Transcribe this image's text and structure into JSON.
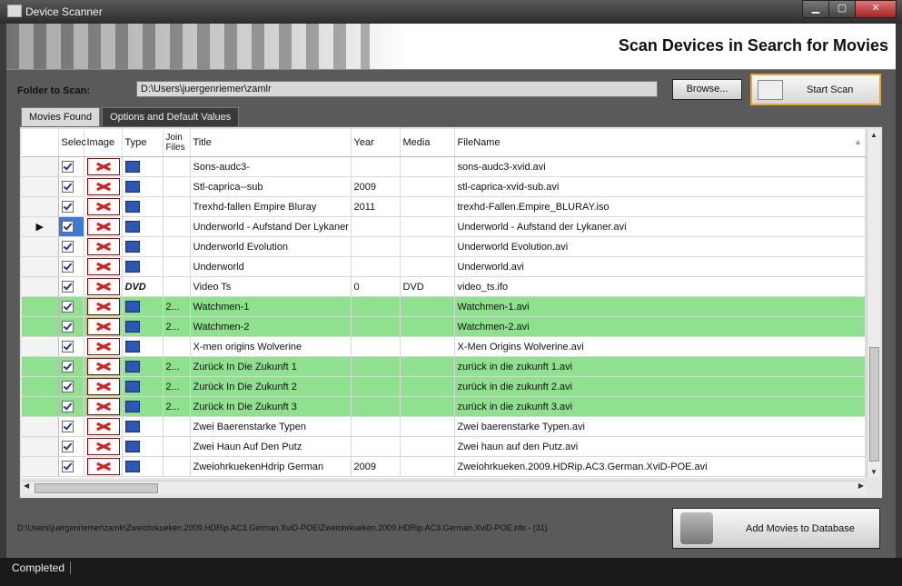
{
  "window": {
    "title": "Device Scanner"
  },
  "banner": {
    "title": "Scan Devices in Search for Movies"
  },
  "folder": {
    "label": "Folder to Scan:",
    "value": "D:\\Users\\juergenriemer\\zamlr"
  },
  "buttons": {
    "browse": "Browse...",
    "start_scan": "Start Scan",
    "add_movies": "Add Movies to Database"
  },
  "tabs": [
    {
      "label": "Movies Found"
    },
    {
      "label": "Options and Default Values"
    }
  ],
  "grid": {
    "columns": [
      "Selec",
      "Image",
      "Type",
      "Join Files",
      "Title",
      "Year",
      "Media",
      "FileName"
    ],
    "rows": [
      {
        "title": "Sons-audc3-",
        "year": "",
        "media": "",
        "join": "",
        "filename": "sons-audc3-xvid.avi",
        "type": "film",
        "hl": false,
        "current": false
      },
      {
        "title": "Stl-caprica--sub",
        "year": "2009",
        "media": "",
        "join": "",
        "filename": "stl-caprica-xvid-sub.avi",
        "type": "film",
        "hl": false,
        "current": false
      },
      {
        "title": "Trexhd-fallen Empire Bluray",
        "year": "2011",
        "media": "",
        "join": "",
        "filename": "trexhd-Fallen.Empire_BLURAY.iso",
        "type": "film",
        "hl": false,
        "current": false
      },
      {
        "title": "Underworld - Aufstand Der Lykaner",
        "year": "",
        "media": "",
        "join": "",
        "filename": "Underworld - Aufstand der Lykaner.avi",
        "type": "film",
        "hl": false,
        "current": true
      },
      {
        "title": "Underworld Evolution",
        "year": "",
        "media": "",
        "join": "",
        "filename": "Underworld Evolution.avi",
        "type": "film",
        "hl": false,
        "current": false
      },
      {
        "title": "Underworld",
        "year": "",
        "media": "",
        "join": "",
        "filename": "Underworld.avi",
        "type": "film",
        "hl": false,
        "current": false
      },
      {
        "title": "Video Ts",
        "year": "0",
        "media": "DVD",
        "join": "",
        "filename": "video_ts.ifo",
        "type": "dvd",
        "hl": false,
        "current": false
      },
      {
        "title": "Watchmen-1",
        "year": "",
        "media": "",
        "join": "2...",
        "filename": "Watchmen-1.avi",
        "type": "film",
        "hl": true,
        "current": false
      },
      {
        "title": "Watchmen-2",
        "year": "",
        "media": "",
        "join": "2...",
        "filename": "Watchmen-2.avi",
        "type": "film",
        "hl": true,
        "current": false
      },
      {
        "title": "X-men origins Wolverine",
        "year": "",
        "media": "",
        "join": "",
        "filename": "X-Men Origins Wolverine.avi",
        "type": "film",
        "hl": false,
        "current": false
      },
      {
        "title": "Zurück In Die Zukunft 1",
        "year": "",
        "media": "",
        "join": "2...",
        "filename": "zurück in die zukunft 1.avi",
        "type": "film",
        "hl": true,
        "current": false
      },
      {
        "title": "Zurück In Die Zukunft 2",
        "year": "",
        "media": "",
        "join": "2...",
        "filename": "zurück in die zukunft 2.avi",
        "type": "film",
        "hl": true,
        "current": false
      },
      {
        "title": "Zurück In Die Zukunft 3",
        "year": "",
        "media": "",
        "join": "2...",
        "filename": "zurück in die zukunft 3.avi",
        "type": "film",
        "hl": true,
        "current": false
      },
      {
        "title": "Zwei Baerenstarke Typen",
        "year": "",
        "media": "",
        "join": "",
        "filename": "Zwei baerenstarke Typen.avi",
        "type": "film",
        "hl": false,
        "current": false
      },
      {
        "title": "Zwei Haun Auf Den Putz",
        "year": "",
        "media": "",
        "join": "",
        "filename": "Zwei haun auf den Putz.avi",
        "type": "film",
        "hl": false,
        "current": false
      },
      {
        "title": "ZweiohrkuekenHdrip  German",
        "year": "2009",
        "media": "",
        "join": "",
        "filename": "Zweiohrkueken.2009.HDRip.AC3.German.XviD-POE.avi",
        "type": "film",
        "hl": false,
        "current": false
      }
    ]
  },
  "status": {
    "path": "D:\\Users\\juergenriemer\\zamlr\\Zweiohrkueken.2009.HDRip.AC3.German.XviD-POE\\Zweiohrkueken.2009.HDRip.AC3.German.XviD-POE.nfo - (31)",
    "text": "Completed"
  },
  "icons": {
    "dvd_label": "DVD"
  }
}
